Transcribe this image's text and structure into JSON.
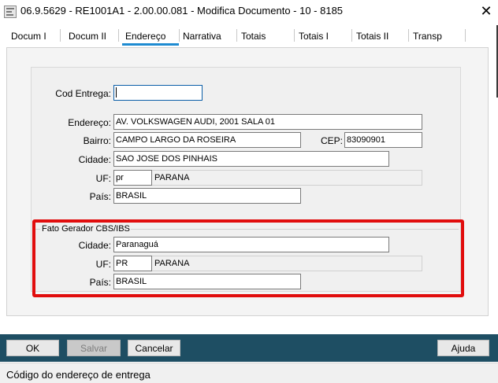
{
  "window": {
    "title": "06.9.5629 - RE1001A1 - 2.00.00.081 - Modifica Documento - 10 - 8185",
    "close_glyph": "✕"
  },
  "tabs": [
    {
      "label": "Docum I"
    },
    {
      "label": "Docum II"
    },
    {
      "label": "Endereço",
      "active": true
    },
    {
      "label": "Narrativa"
    },
    {
      "label": "Totais"
    },
    {
      "label": "Totais I"
    },
    {
      "label": "Totais II"
    },
    {
      "label": "Transp"
    }
  ],
  "form": {
    "cod_entrega": {
      "label": "Cod Entrega:",
      "value": ""
    },
    "endereco": {
      "label": "Endereço:",
      "value": "AV. VOLKSWAGEN AUDI, 2001 SALA 01"
    },
    "bairro": {
      "label": "Bairro:",
      "value": "CAMPO LARGO DA ROSEIRA"
    },
    "cep": {
      "label": "CEP:",
      "value": "83090901"
    },
    "cidade": {
      "label": "Cidade:",
      "value": "SAO JOSE DOS PINHAIS"
    },
    "uf": {
      "label": "UF:",
      "value": "pr",
      "description": "PARANA"
    },
    "pais": {
      "label": "País:",
      "value": "BRASIL"
    }
  },
  "fato_gerador": {
    "title": "Fato Gerador CBS/IBS",
    "cidade": {
      "label": "Cidade:",
      "value": "Paranaguá"
    },
    "uf": {
      "label": "UF:",
      "value": "PR",
      "description": "PARANA"
    },
    "pais": {
      "label": "País:",
      "value": "BRASIL"
    }
  },
  "buttons": {
    "ok": "OK",
    "salvar": "Salvar",
    "cancelar": "Cancelar",
    "ajuda": "Ajuda"
  },
  "status_bar": {
    "text": "Código do endereço de entrega"
  },
  "colors": {
    "footer": "#1e4e63",
    "tab_accent": "#1e8bd1",
    "highlight": "#e10d0d"
  }
}
